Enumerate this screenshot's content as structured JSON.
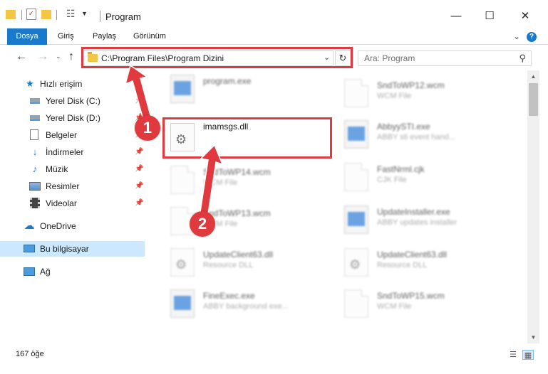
{
  "window": {
    "title": "Program",
    "minimize": "—",
    "maximize": "☐",
    "close": "✕"
  },
  "ribbon": {
    "tabs": [
      "Dosya",
      "Giriş",
      "Paylaş",
      "Görünüm"
    ],
    "help": "?"
  },
  "address": {
    "path": "C:\\Program Files\\Program Dizini",
    "search_placeholder": "Ara: Program"
  },
  "sidebar": {
    "items": [
      {
        "label": "Hızlı erişim",
        "icon": "star-icon"
      },
      {
        "label": "Yerel Disk (C:)",
        "icon": "drive-icon"
      },
      {
        "label": "Yerel Disk (D:)",
        "icon": "drive-icon"
      },
      {
        "label": "Belgeler",
        "icon": "documents-icon"
      },
      {
        "label": "İndirmeler",
        "icon": "download-icon"
      },
      {
        "label": "Müzik",
        "icon": "music-icon"
      },
      {
        "label": "Resimler",
        "icon": "pictures-icon"
      },
      {
        "label": "Videolar",
        "icon": "video-icon"
      },
      {
        "label": "OneDrive",
        "icon": "cloud-icon"
      },
      {
        "label": "Bu bilgisayar",
        "icon": "computer-icon"
      },
      {
        "label": "Ağ",
        "icon": "network-icon"
      }
    ]
  },
  "files": {
    "left": [
      {
        "name": "program.exe",
        "desc": ""
      },
      {
        "name": "imamsgs.dll",
        "desc": ""
      },
      {
        "name": "SndToWP14.wcm",
        "desc": "WCM File"
      },
      {
        "name": "SndToWP13.wcm",
        "desc": "WCM File"
      },
      {
        "name": "UpdateClient63.dll",
        "desc": "Resource DLL"
      },
      {
        "name": "FineExec.exe",
        "desc": "ABBY background exe..."
      }
    ],
    "right": [
      {
        "name": "SndToWP12.wcm",
        "desc": "WCM File"
      },
      {
        "name": "AbbyySTI.exe",
        "desc": "ABBY sti event hand..."
      },
      {
        "name": "FastNrml.cjk",
        "desc": "CJK File"
      },
      {
        "name": "UpdateInstaller.exe",
        "desc": "ABBY updates installer"
      },
      {
        "name": "UpdateClient63.dll",
        "desc": "Resource DLL"
      },
      {
        "name": "SndToWP15.wcm",
        "desc": "WCM File"
      }
    ]
  },
  "annotations": {
    "step1": "1",
    "step2": "2",
    "highlight_color": "#e03a3e"
  },
  "status": {
    "count": "167 öğe"
  },
  "colors": {
    "accent": "#1979ca",
    "selected": "#cce8ff"
  }
}
